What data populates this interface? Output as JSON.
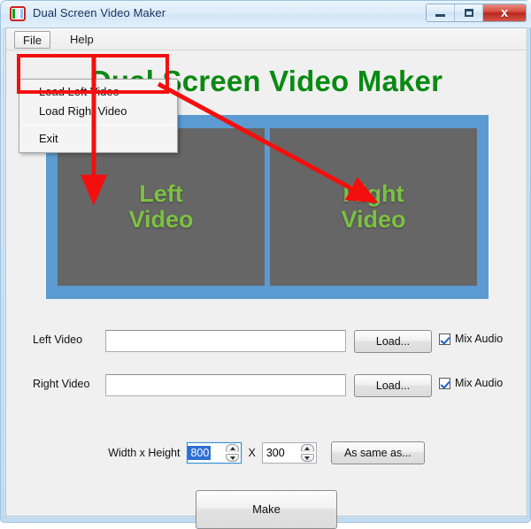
{
  "window": {
    "title": "Dual Screen Video Maker",
    "icon": "dual-screen-icon",
    "controls": {
      "minimize": "–",
      "maximize": "□",
      "close": "x"
    }
  },
  "menubar": {
    "items": [
      {
        "label": "File",
        "active": true
      },
      {
        "label": "Help",
        "active": false
      }
    ]
  },
  "dropdown": {
    "open": true,
    "items": [
      {
        "label": "Load Left Video"
      },
      {
        "label": "Load Right Video"
      },
      {
        "separator": true
      },
      {
        "label": "Exit"
      }
    ]
  },
  "headline": "Dual Screen Video Maker",
  "preview": {
    "background_color": "#5b9bd1",
    "pane_color": "#666666",
    "text_color": "#7cc142",
    "left": {
      "line1": "Left",
      "line2": "Video"
    },
    "right": {
      "line1": "Right",
      "line2": "Video"
    }
  },
  "form": {
    "left_row": {
      "label": "Left Video",
      "value": "",
      "placeholder": "",
      "button": "Load...",
      "checkbox_label": "Mix Audio",
      "checked": true
    },
    "right_row": {
      "label": "Right Video",
      "value": "",
      "placeholder": "",
      "button": "Load...",
      "checkbox_label": "Mix Audio",
      "checked": true
    },
    "size": {
      "label": "Width x Height",
      "width_value": "800",
      "separator": "X",
      "height_value": "300",
      "same_as_button": "As same as..."
    },
    "make_button": "Make"
  },
  "annotations": {
    "highlight_color": "#f40f0f",
    "rect_target": "load-menu-items",
    "arrow_down_target": "left-video-pane",
    "arrow_diagonal_target": "right-video-pane"
  }
}
